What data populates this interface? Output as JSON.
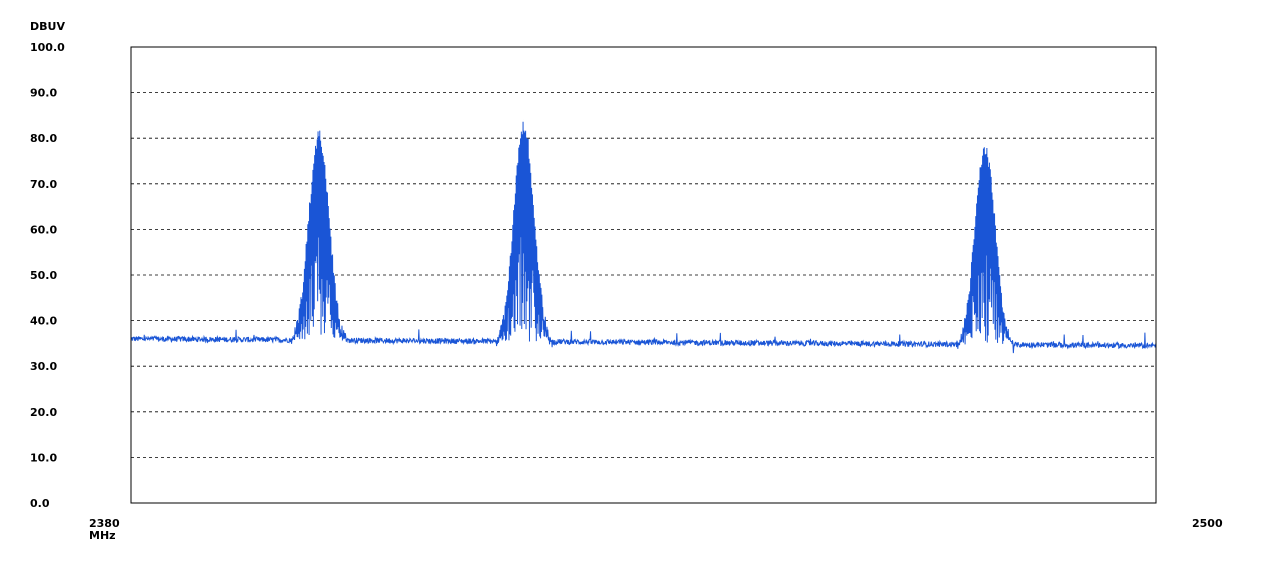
{
  "chart_data": {
    "type": "line",
    "title": "",
    "ylabel": "DBUV",
    "xlabel": "MHz",
    "xlim": [
      2380,
      2500
    ],
    "ylim": [
      0,
      100
    ],
    "y_ticks": [
      "0.0",
      "10.0",
      "20.0",
      "30.0",
      "40.0",
      "50.0",
      "60.0",
      "70.0",
      "80.0",
      "90.0",
      "100.0"
    ],
    "x_tick_labels": {
      "start": "2380",
      "end": "2500",
      "unit": "MHz"
    },
    "grid": true,
    "series": [
      {
        "color": "#1a55d6",
        "baseline_start": 36.0,
        "baseline_end": 34.5,
        "peaks": [
          {
            "center_mhz": 2402,
            "peak_dbuv": 82
          },
          {
            "center_mhz": 2426,
            "peak_dbuv": 84
          },
          {
            "center_mhz": 2480,
            "peak_dbuv": 79
          }
        ]
      }
    ]
  }
}
